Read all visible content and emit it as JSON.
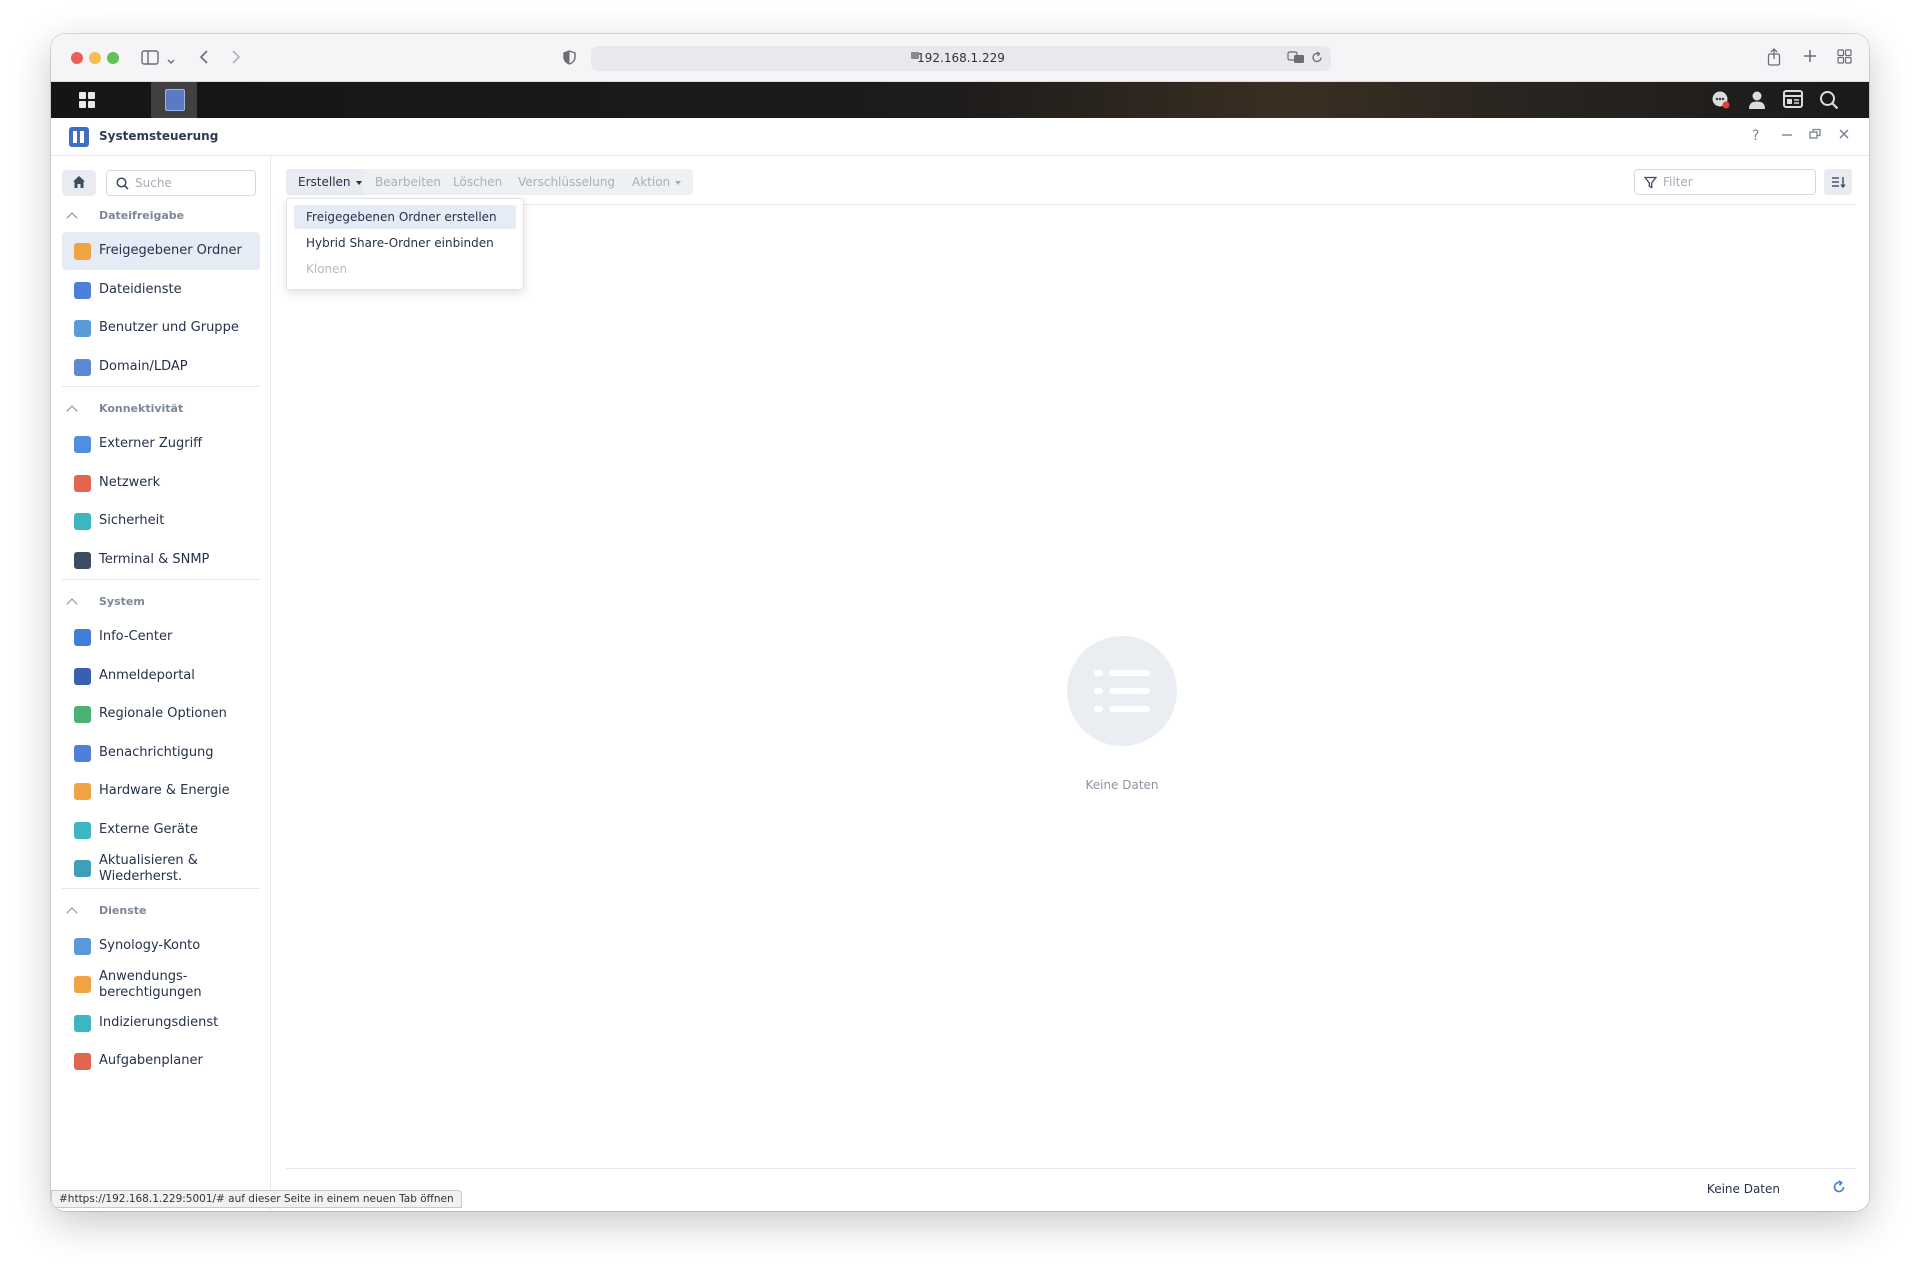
{
  "browser": {
    "url": "192.168.1.229",
    "status_url": "#https://192.168.1.229:5001/# auf dieser Seite in einem neuen Tab öffnen"
  },
  "app": {
    "title": "Systemsteuerung",
    "help": "?"
  },
  "sidebar": {
    "search_placeholder": "Suche",
    "sections": [
      {
        "title": "Dateifreigabe",
        "items": [
          {
            "label": "Freigegebener Ordner",
            "icon": "shared-folder-icon",
            "color": "#f0a342",
            "active": true
          },
          {
            "label": "Dateidienste",
            "icon": "file-services-icon",
            "color": "#4c7fd8"
          },
          {
            "label": "Benutzer und Gruppe",
            "icon": "user-group-icon",
            "color": "#5a9ad8"
          },
          {
            "label": "Domain/LDAP",
            "icon": "domain-ldap-icon",
            "color": "#5d88d6"
          }
        ]
      },
      {
        "title": "Konnektivität",
        "items": [
          {
            "label": "Externer Zugriff",
            "icon": "external-access-icon",
            "color": "#4f8fe0"
          },
          {
            "label": "Netzwerk",
            "icon": "network-icon",
            "color": "#e2654f"
          },
          {
            "label": "Sicherheit",
            "icon": "shield-icon",
            "color": "#3cb6c0"
          },
          {
            "label": "Terminal & SNMP",
            "icon": "terminal-icon",
            "color": "#3d4b63"
          }
        ]
      },
      {
        "title": "System",
        "items": [
          {
            "label": "Info-Center",
            "icon": "info-icon",
            "color": "#3f7fd8"
          },
          {
            "label": "Anmeldeportal",
            "icon": "login-portal-icon",
            "color": "#3a5fb0"
          },
          {
            "label": "Regionale Optionen",
            "icon": "regional-options-icon",
            "color": "#4caf73"
          },
          {
            "label": "Benachrichtigung",
            "icon": "notification-icon",
            "color": "#4f7fd8"
          },
          {
            "label": "Hardware & Energie",
            "icon": "bulb-icon",
            "color": "#f0a342"
          },
          {
            "label": "Externe Geräte",
            "icon": "external-devices-icon",
            "color": "#3cb6c0"
          },
          {
            "label": "Aktualisieren & Wiederherst.",
            "icon": "update-restore-icon",
            "color": "#3da0b8"
          }
        ]
      },
      {
        "title": "Dienste",
        "items": [
          {
            "label": "Synology-Konto",
            "icon": "synology-account-icon",
            "color": "#5a9ad8"
          },
          {
            "label": "Anwendungs-berechtigungen",
            "icon": "lock-icon",
            "color": "#f0a342"
          },
          {
            "label": "Indizierungsdienst",
            "icon": "indexing-icon",
            "color": "#3cb6c0"
          },
          {
            "label": "Aufgabenplaner",
            "icon": "calendar-icon",
            "color": "#e2654f"
          }
        ]
      }
    ]
  },
  "toolbar": {
    "create": "Erstellen",
    "edit": "Bearbeiten",
    "delete": "Löschen",
    "encryption": "Verschlüsselung",
    "action": "Aktion",
    "filter_placeholder": "Filter"
  },
  "dropdown": {
    "items": [
      {
        "label": "Freigegebenen Ordner erstellen"
      },
      {
        "label": "Hybrid Share-Ordner einbinden"
      },
      {
        "label": "Klonen"
      }
    ]
  },
  "main": {
    "empty_text": "Keine Daten",
    "footer_text": "Keine Daten"
  },
  "colors": {
    "accent": "#3f6fc3",
    "active_bg": "#e6ecf5"
  }
}
